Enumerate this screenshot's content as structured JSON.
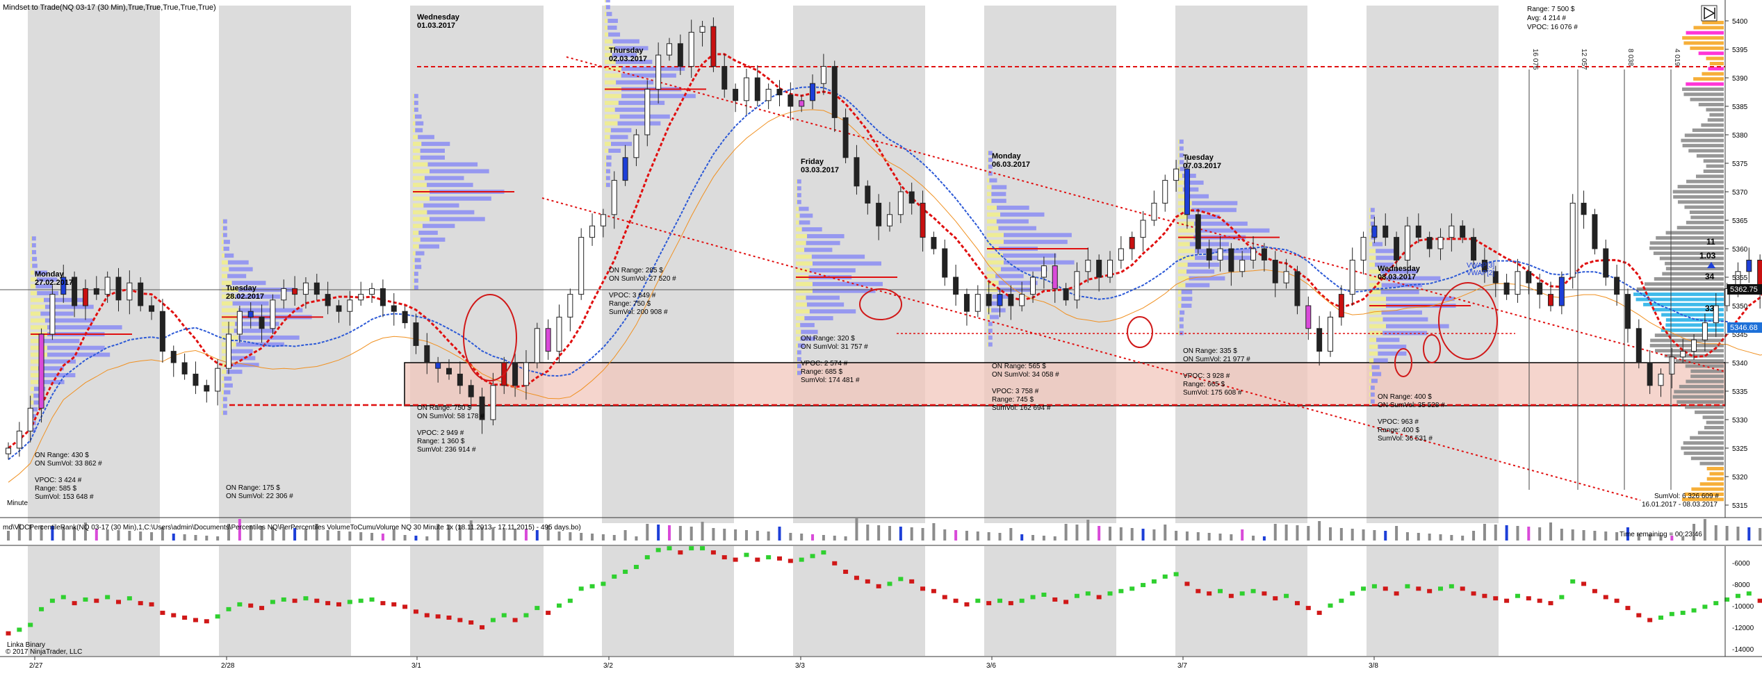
{
  "window": {
    "title": "Mindset to Trade(NQ 03-17 (30 Min),True,True,True,True,True)"
  },
  "stats_box": {
    "range": "Range: 7 500 $",
    "avg": "Avg:    4 214 #",
    "vpoc": "VPOC:  16 076 #"
  },
  "price_axis": {
    "ticks": [
      5400,
      5395,
      5390,
      5385,
      5380,
      5375,
      5370,
      5365,
      5360,
      5355,
      5350,
      5345,
      5340,
      5335,
      5330,
      5325,
      5320,
      5315
    ],
    "current_price": "5362.75",
    "vwap_price": "5346.68"
  },
  "volume_panel": {
    "title": "md\\VOCPercentileRank(NQ 03-17 (30 Min),1,C:\\Users\\admin\\Documents\\Percentiles NQ\\PerPercentiles VolumeToCumuVolume NQ 30 Minute 1x (18.11.2013 - 17.11.2015) - 495 days.bo)",
    "time_remaining": "Time remaining = 00:23:46"
  },
  "binary_panel": {
    "label": "Linka Binary",
    "copyright": "© 2017 NinjaTrader, LLC",
    "ticks": [
      "-6000",
      "-8000",
      "-10000",
      "-12000",
      "-14000"
    ]
  },
  "minute_label": "Minute",
  "x_axis": {
    "labels": [
      "2/27",
      "2/28",
      "3/1",
      "3/2",
      "3/3",
      "3/6",
      "3/7",
      "3/8"
    ]
  },
  "days": [
    {
      "day": "Monday",
      "date": "27.02.2017",
      "on_range": "ON Range:    430 $",
      "on_sumvol": "ON SumVol:  33 862 #",
      "vpoc": "VPOC:    3 424 #",
      "range": "Range:     585 $",
      "sumvol": "SumVol:  153 648 #"
    },
    {
      "day": "Tuesday",
      "date": "28.02.2017",
      "on_range": "ON Range:    175 $",
      "on_sumvol": "ON SumVol:  22 306 #",
      "vpoc": "",
      "range": "",
      "sumvol": ""
    },
    {
      "day": "Wednesday",
      "date": "01.03.2017",
      "on_range": "ON Range:    750 $",
      "on_sumvol": "ON SumVol:  58 178 #",
      "vpoc": "VPOC:    2 949 #",
      "range": "Range:    1 360 $",
      "sumvol": "SumVol:  236 914 #"
    },
    {
      "day": "Thursday",
      "date": "02.03.2017",
      "on_range": "ON Range:    285 $",
      "on_sumvol": "ON SumVol:  27 520 #",
      "vpoc": "VPOC:    3 649 #",
      "range": "Range:     750 $",
      "sumvol": "SumVol:  200 908 #"
    },
    {
      "day": "Friday",
      "date": "03.03.2017",
      "on_range": "ON Range:    320 $",
      "on_sumvol": "ON SumVol:  31 757 #",
      "vpoc": "VPOC:    2 574 #",
      "range": "Range:     685 $",
      "sumvol": "SumVol:  174 481 #"
    },
    {
      "day": "Monday",
      "date": "06.03.2017",
      "on_range": "ON Range:    565 $",
      "on_sumvol": "ON SumVol:  34 058 #",
      "vpoc": "VPOC:    3 758 #",
      "range": "Range:     745 $",
      "sumvol": "SumVol:  162 694 #"
    },
    {
      "day": "Tuesday",
      "date": "07.03.2017",
      "on_range": "ON Range:    335 $",
      "on_sumvol": "ON SumVol:  21 977 #",
      "vpoc": "VPOC:    3 928 #",
      "range": "Range:     665 $",
      "sumvol": "SumVol:  175 608 #"
    },
    {
      "day": "Wednesday",
      "date": "08.03.2017",
      "on_range": "ON Range:    400 $",
      "on_sumvol": "ON SumVol:  35 528 #",
      "vpoc": "VPOC:     963 #",
      "range": "Range:     400 $",
      "sumvol": "SumVol:   36 531 #"
    }
  ],
  "vertical_labels": [
    "16 076",
    "12 057",
    "8 038",
    "4 019"
  ],
  "vwap_labels": [
    "VWAP[3]",
    "VWAP[2]"
  ],
  "right_annot": {
    "a": "11",
    "b": "1.03",
    "c": "34",
    "d": "33"
  },
  "bottom_right": {
    "sumvol": "SumVol: 6 326 609 #",
    "span": "16.01.2017 - 08.03.2017"
  },
  "chart_data": {
    "type": "candlestick",
    "title": "Mindset to Trade(NQ 03-17 (30 Min),True,True,True,True,True)",
    "instrument": "NQ 03-17",
    "timeframe": "30 Min",
    "y_range": [
      5313,
      5405
    ],
    "x_labels": [
      "2/27",
      "2/28",
      "3/1",
      "3/2",
      "3/3",
      "3/6",
      "3/7",
      "3/8"
    ],
    "closes": [
      5325,
      5328,
      5332,
      5345,
      5352,
      5355,
      5350,
      5353,
      5352,
      5355,
      5351,
      5354,
      5350,
      5349,
      5342,
      5340,
      5338,
      5336,
      5335,
      5339,
      5345,
      5349,
      5348,
      5346,
      5351,
      5353,
      5352,
      5354,
      5352,
      5350,
      5349,
      5351,
      5352,
      5353,
      5350,
      5349,
      5347,
      5343,
      5340,
      5339,
      5338,
      5336,
      5334,
      5330,
      5336,
      5340,
      5336,
      5340,
      5346,
      5342,
      5348,
      5352,
      5362,
      5364,
      5366,
      5372,
      5376,
      5380,
      5388,
      5394,
      5396,
      5392,
      5398,
      5399,
      5392,
      5388,
      5386,
      5390,
      5386,
      5388,
      5387,
      5385,
      5386,
      5389,
      5392,
      5383,
      5376,
      5371,
      5368,
      5364,
      5366,
      5370,
      5368,
      5362,
      5360,
      5355,
      5352,
      5349,
      5352,
      5350,
      5352,
      5350,
      5352,
      5355,
      5357,
      5353,
      5351,
      5356,
      5358,
      5355,
      5358,
      5360,
      5362,
      5365,
      5368,
      5372,
      5374,
      5366,
      5360,
      5358,
      5360,
      5356,
      5358,
      5360,
      5358,
      5354,
      5356,
      5350,
      5346,
      5342,
      5348,
      5352,
      5358,
      5362,
      5364,
      5362,
      5358,
      5364,
      5362,
      5360,
      5362,
      5364,
      5362,
      5358,
      5356,
      5354,
      5352,
      5356,
      5354,
      5352,
      5350,
      5355,
      5368,
      5366,
      5360,
      5355,
      5352,
      5346,
      5340,
      5336,
      5338,
      5341,
      5342,
      5344,
      5347,
      5350,
      5353,
      5356,
      5358,
      5352,
      5360,
      5362.75
    ],
    "current_price": 5362.75,
    "vwap_price": 5346.68,
    "sessions": [
      {
        "label": "Monday 27.02.2017",
        "vpoc": 3424,
        "range": 585,
        "sumvol": 153648,
        "on_range": 430,
        "on_sumvol": 33862
      },
      {
        "label": "Tuesday 28.02.2017",
        "on_range": 175,
        "on_sumvol": 22306
      },
      {
        "label": "Wednesday 01.03.2017",
        "vpoc": 2949,
        "range": 1360,
        "sumvol": 236914,
        "on_range": 750,
        "on_sumvol": 58178
      },
      {
        "label": "Thursday 02.03.2017",
        "vpoc": 3649,
        "range": 750,
        "sumvol": 200908,
        "on_range": 285,
        "on_sumvol": 27520
      },
      {
        "label": "Friday 03.03.2017",
        "vpoc": 2574,
        "range": 685,
        "sumvol": 174481,
        "on_range": 320,
        "on_sumvol": 31757
      },
      {
        "label": "Monday 06.03.2017",
        "vpoc": 3758,
        "range": 745,
        "sumvol": 162694,
        "on_range": 565,
        "on_sumvol": 34058
      },
      {
        "label": "Tuesday 07.03.2017",
        "vpoc": 3928,
        "range": 665,
        "sumvol": 175608,
        "on_range": 335,
        "on_sumvol": 21977
      },
      {
        "label": "Wednesday 08.03.2017",
        "vpoc": 963,
        "range": 400,
        "sumvol": 36531,
        "on_range": 400,
        "on_sumvol": 35528
      }
    ],
    "zone": {
      "top": 5339,
      "bottom": 5332
    },
    "red_levels": [
      5394.5,
      5332,
      5346
    ],
    "binary_range": [
      -15000,
      -5000
    ]
  }
}
